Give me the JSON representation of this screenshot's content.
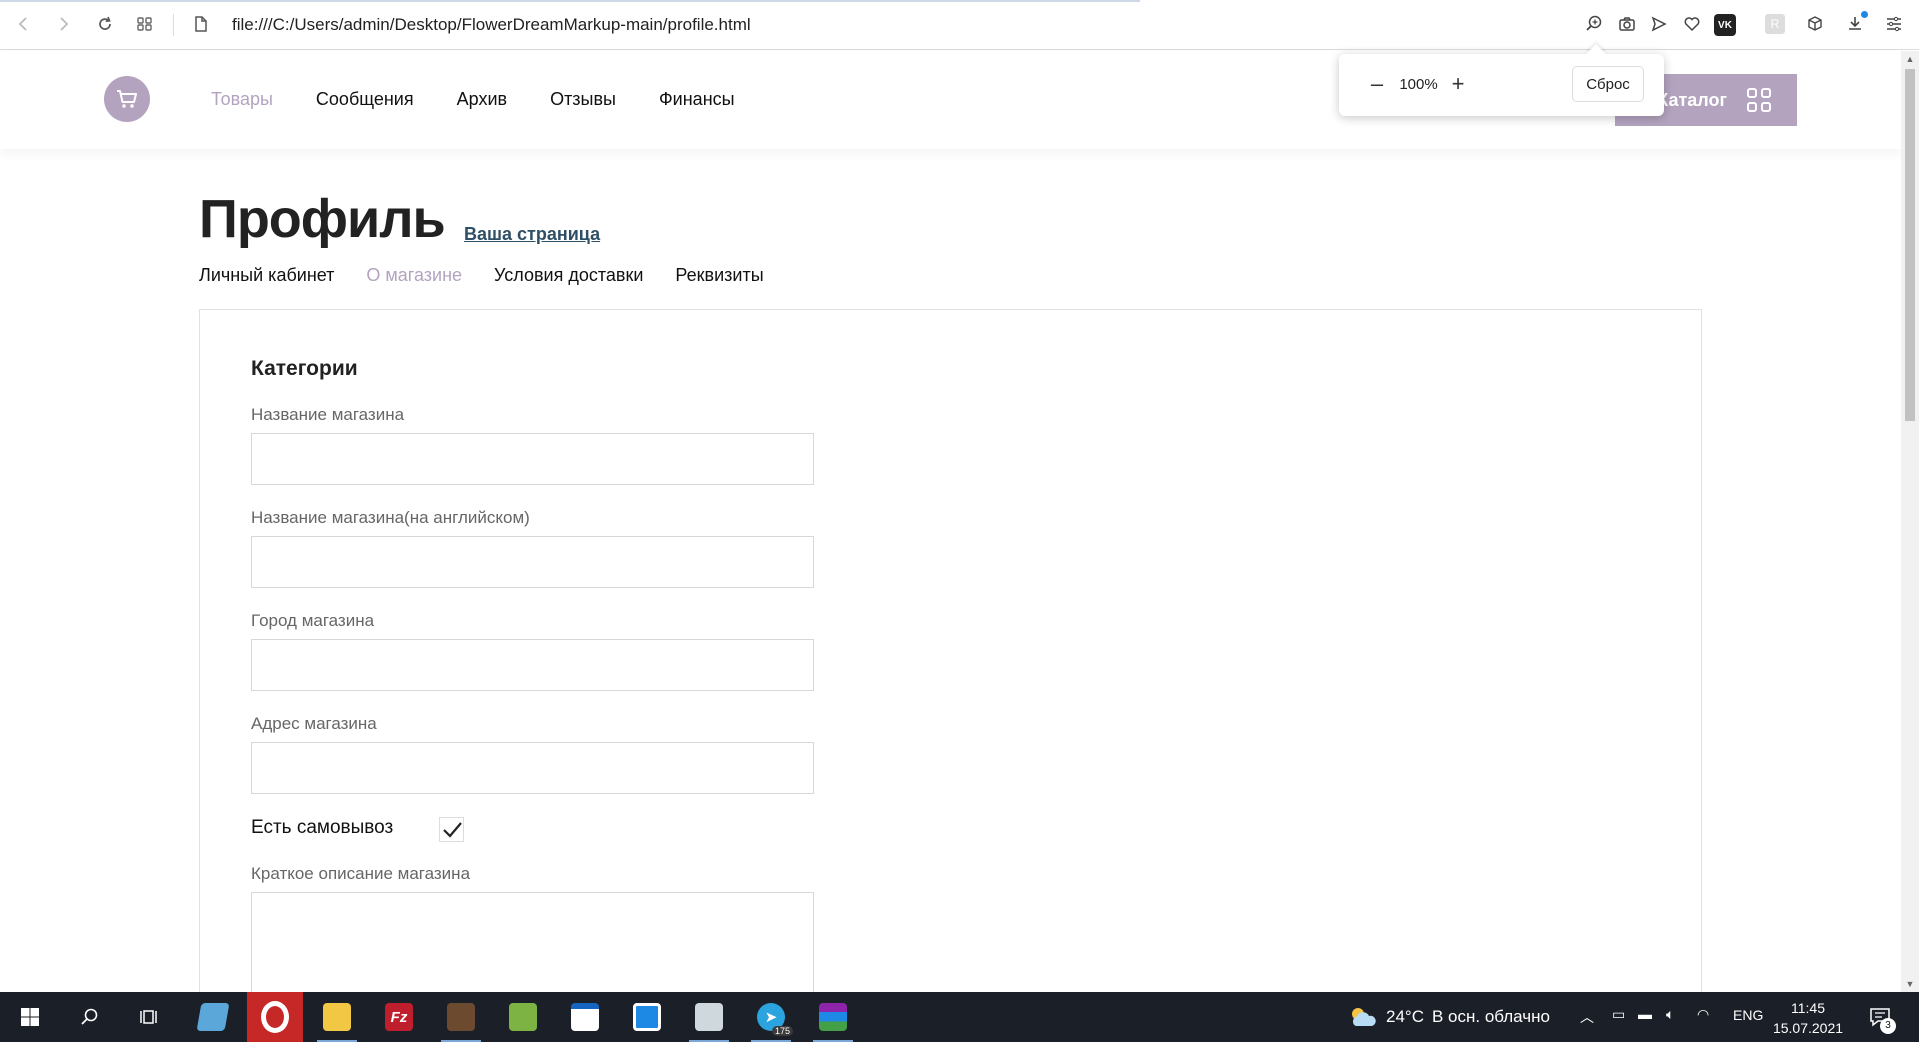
{
  "browser": {
    "url": "file:///C:/Users/admin/Desktop/FlowerDreamMarkup-main/profile.html",
    "extension_icons": [
      "zoom-icon",
      "camera-icon",
      "send-icon",
      "heart-icon",
      "vk-icon",
      "r-extension-icon",
      "box-icon",
      "download-icon",
      "menu-icon"
    ],
    "vk_label": "VK",
    "r_label": "R"
  },
  "zoom_popup": {
    "minus": "–",
    "level": "100%",
    "plus": "+",
    "reset": "Сброс"
  },
  "site": {
    "nav": [
      {
        "label": "Товары",
        "active": true
      },
      {
        "label": "Сообщения",
        "active": false
      },
      {
        "label": "Архив",
        "active": false
      },
      {
        "label": "Отзывы",
        "active": false
      },
      {
        "label": "Финансы",
        "active": false
      }
    ],
    "catalog_label": "Каталог",
    "accent_color": "#b3a3bf"
  },
  "profile": {
    "title": "Профиль",
    "your_page_link": "Ваша страница",
    "tabs": [
      {
        "label": "Личный кабинет",
        "active": false
      },
      {
        "label": "О магазине",
        "active": true
      },
      {
        "label": "Условия доставки",
        "active": false
      },
      {
        "label": "Реквизиты",
        "active": false
      }
    ],
    "section_title": "Категории",
    "fields": [
      {
        "label": "Название магазина",
        "value": ""
      },
      {
        "label": "Название магазина(на английском)",
        "value": ""
      },
      {
        "label": "Город магазина",
        "value": ""
      },
      {
        "label": "Адрес магазина",
        "value": ""
      }
    ],
    "pickup_label": "Есть самовывоз",
    "pickup_checked": true,
    "description_label": "Краткое описание магазина",
    "description_value": ""
  },
  "taskbar": {
    "weather_temp": "24°C",
    "weather_text": "В осн. облачно",
    "language": "ENG",
    "time": "11:45",
    "date": "15.07.2021",
    "telegram_badge": "175",
    "notification_count": "3"
  }
}
